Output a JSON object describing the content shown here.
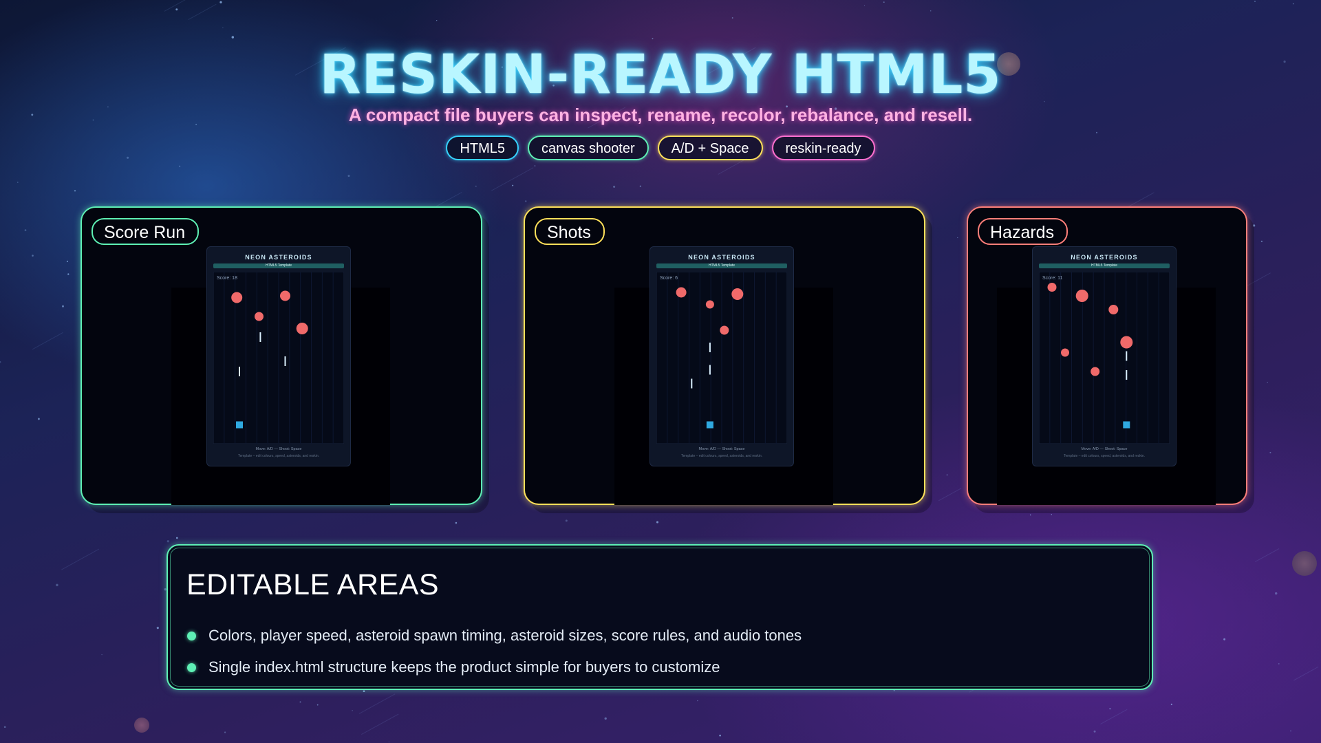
{
  "header": {
    "title": "RESKIN-READY HTML5",
    "subtitle": "A compact file buyers can inspect, rename, recolor, rebalance, and resell.",
    "tags": [
      "HTML5",
      "canvas shooter",
      "A/D + Space",
      "reskin-ready"
    ]
  },
  "colors": {
    "mint": "#5ef0b5",
    "yellow": "#ffe15a",
    "coral": "#ff7f7a",
    "cyan": "#36d3ff",
    "pink": "#ff6fcf",
    "asteroid": "#f06a6a",
    "player": "#2fa9e0"
  },
  "cards": [
    {
      "label": "Score Run",
      "game": {
        "title": "NEON ASTEROIDS",
        "badge": "HTML5 Template",
        "score": "Score: 18",
        "controls": "Move: A/D — Shoot: Space",
        "note": "Template – edit colours, speed, asteroids, and reskin.",
        "asteroids": [
          [
            0.18,
            0.15,
            8
          ],
          [
            0.55,
            0.14,
            7.5
          ],
          [
            0.35,
            0.26,
            6.5
          ],
          [
            0.68,
            0.33,
            8.5
          ]
        ],
        "bullets": [
          [
            0.36,
            0.38
          ],
          [
            0.55,
            0.52
          ],
          [
            0.2,
            0.58
          ]
        ],
        "player": [
          0.2,
          0.89
        ]
      }
    },
    {
      "label": "Shots",
      "game": {
        "title": "NEON ASTEROIDS",
        "badge": "HTML5 Template",
        "score": "Score: 6",
        "controls": "Move: A/D — Shoot: Space",
        "note": "Template – edit colours, speed, asteroids, and reskin.",
        "asteroids": [
          [
            0.19,
            0.12,
            7.5
          ],
          [
            0.41,
            0.19,
            6
          ],
          [
            0.62,
            0.13,
            8.5
          ],
          [
            0.52,
            0.34,
            6.5
          ]
        ],
        "bullets": [
          [
            0.41,
            0.44
          ],
          [
            0.41,
            0.57
          ],
          [
            0.27,
            0.65
          ]
        ],
        "player": [
          0.41,
          0.89
        ]
      }
    },
    {
      "label": "Hazards",
      "game": {
        "title": "NEON ASTEROIDS",
        "badge": "HTML5 Template",
        "score": "Score: 11",
        "controls": "Move: A/D — Shoot: Space",
        "note": "Template – edit colours, speed, asteroids, and reskin.",
        "asteroids": [
          [
            0.1,
            0.09,
            6.5
          ],
          [
            0.33,
            0.14,
            9
          ],
          [
            0.57,
            0.22,
            7
          ],
          [
            0.67,
            0.41,
            9
          ],
          [
            0.2,
            0.47,
            6
          ],
          [
            0.43,
            0.58,
            6.5
          ]
        ],
        "bullets": [
          [
            0.67,
            0.49
          ],
          [
            0.67,
            0.6
          ]
        ],
        "player": [
          0.67,
          0.89
        ]
      }
    }
  ],
  "editable": {
    "title": "EDITABLE AREAS",
    "items": [
      "Colors, player speed, asteroid spawn timing, asteroid sizes, score rules, and audio tones",
      "Single index.html structure keeps the product simple for buyers to customize"
    ]
  }
}
